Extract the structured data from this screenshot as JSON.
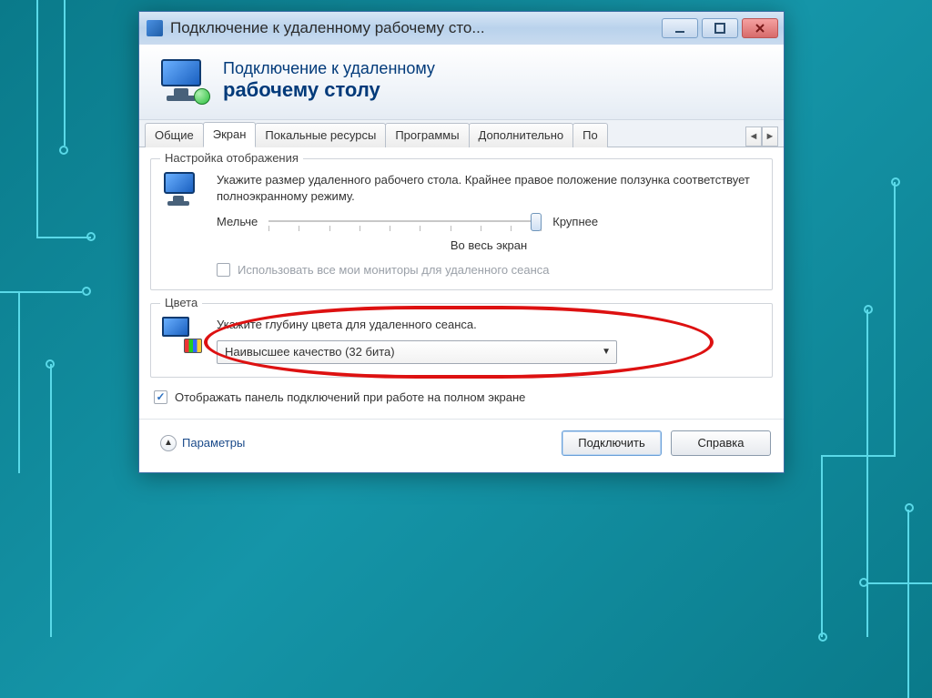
{
  "titlebar": {
    "title": "Подключение к удаленному рабочему сто..."
  },
  "header": {
    "line1": "Подключение к удаленному",
    "line2": "рабочему столу"
  },
  "tabs": {
    "t0": "Общие",
    "t1": "Экран",
    "t2": "Покальные ресурсы",
    "t3": "Программы",
    "t4": "Дополнительно",
    "t5": "По"
  },
  "display_group": {
    "title": "Настройка отображения",
    "desc": "Укажите размер удаленного рабочего стола. Крайнее правое положение ползунка соответствует полноэкранному режиму.",
    "slider_min": "Мельче",
    "slider_max": "Крупнее",
    "slider_value_label": "Во весь экран",
    "all_monitors_label": "Использовать все мои мониторы для удаленного сеанса"
  },
  "colors_group": {
    "title": "Цвета",
    "desc": "Укажите глубину цвета для удаленного сеанса.",
    "dropdown_value": "Наивысшее качество (32 бита)"
  },
  "connection_bar_label": "Отображать панель подключений при работе на полном экране",
  "footer": {
    "params": "Параметры",
    "connect": "Подключить",
    "help": "Справка"
  }
}
